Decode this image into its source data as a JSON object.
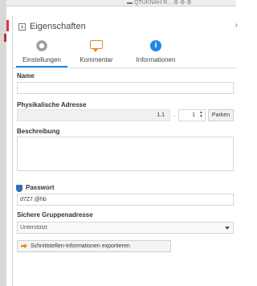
{
  "topbar": {
    "widget_text": "▬ QTUKNAH R...    ⚙  ⚙  ⚙"
  },
  "panel": {
    "title": "Eigenschaften",
    "close": "›"
  },
  "tabs": [
    {
      "label": "Einstellungen",
      "icon": "gear-icon"
    },
    {
      "label": "Kommentar",
      "icon": "comment-icon"
    },
    {
      "label": "Informationen",
      "icon": "info-icon"
    }
  ],
  "form": {
    "name_label": "Name",
    "name_value": "",
    "phys_label": "Physikalische Adresse",
    "phys_prefix": "1.1",
    "phys_separator": ".",
    "phys_number": "1",
    "park_button": "Parken",
    "desc_label": "Beschreibung",
    "desc_value": "",
    "password_label": "Passwort",
    "password_value": "d7Z7.@hb",
    "group_label": "Sichere Gruppenadresse",
    "group_value": "Unterstützt",
    "export_button": "Schnittstellen-Informationen exportieren"
  },
  "colors": {
    "accent": "#1e88e5",
    "comment": "#e08a1e",
    "shield": "#2f6fb3"
  }
}
